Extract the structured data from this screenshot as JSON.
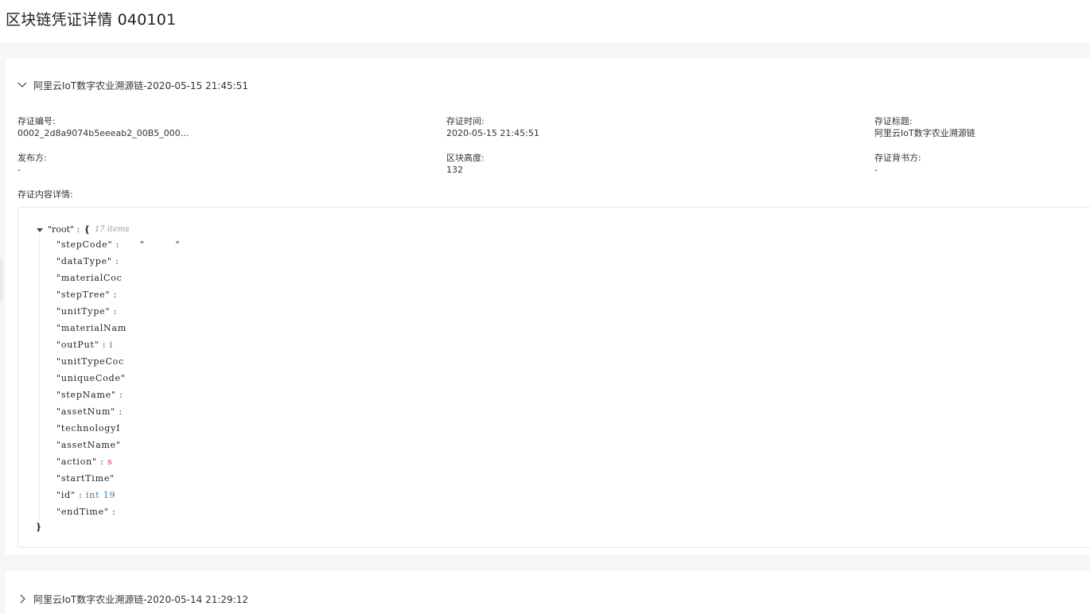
{
  "page": {
    "title": "区块链凭证详情 040101"
  },
  "cards": [
    {
      "header": "阿里云IoT数字农业溯源链-2020-05-15 21:45:51",
      "expanded": true,
      "fields": {
        "cert_no_label": "存证编号:",
        "cert_no_value": "0002_2d8a9074b5eeeab2_00B5_000...",
        "cert_time_label": "存证时间:",
        "cert_time_value": "2020-05-15 21:45:51",
        "cert_title_label": "存证标题:",
        "cert_title_value": "阿里云IoT数字农业溯源链",
        "publisher_label": "发布方:",
        "publisher_value": "-",
        "block_height_label": "区块高度:",
        "block_height_value": "132",
        "endorser_label": "存证背书方:",
        "endorser_value": "-",
        "content_label": "存证内容详情:"
      },
      "json_view": {
        "root_key": "\"root\"",
        "root_sep": " : ",
        "root_open": "{",
        "root_count": "17 items",
        "root_close": "}",
        "rows": [
          {
            "key": "\"stepCode\"",
            "rest": " :      \"         \""
          },
          {
            "key": "\"dataType\"",
            "rest": " :"
          },
          {
            "key": "\"materialCoc",
            "rest": ""
          },
          {
            "key": "\"stepTree\"",
            "rest": " :"
          },
          {
            "key": "\"unitType\"",
            "rest": " :"
          },
          {
            "key": "\"materialNam",
            "rest": ""
          },
          {
            "key": "\"outPut\"",
            "rest": " : ",
            "type": "int",
            "value": "i"
          },
          {
            "key": "\"unitTypeCoc",
            "rest": ""
          },
          {
            "key": "\"uniqueCode\"",
            "rest": ""
          },
          {
            "key": "\"stepName\"",
            "rest": " :"
          },
          {
            "key": "\"assetNum\"",
            "rest": " :"
          },
          {
            "key": "\"technologyI",
            "rest": ""
          },
          {
            "key": "\"assetName\"",
            "rest": ""
          },
          {
            "key": "\"action\"",
            "rest": " : ",
            "type": "str",
            "value": "s"
          },
          {
            "key": "\"startTime\"",
            "rest": ""
          },
          {
            "key": "\"id\"",
            "rest": " : ",
            "type": "int",
            "value": "int 19"
          },
          {
            "key": "\"endTime\"",
            "rest": " :"
          }
        ]
      }
    },
    {
      "header": "阿里云IoT数字农业溯源链-2020-05-14 21:29:12",
      "expanded": false
    }
  ],
  "icons": {
    "expanded": "chevron-down-icon",
    "collapsed": "chevron-right-icon",
    "tree_toggle": "caret-down-icon"
  }
}
